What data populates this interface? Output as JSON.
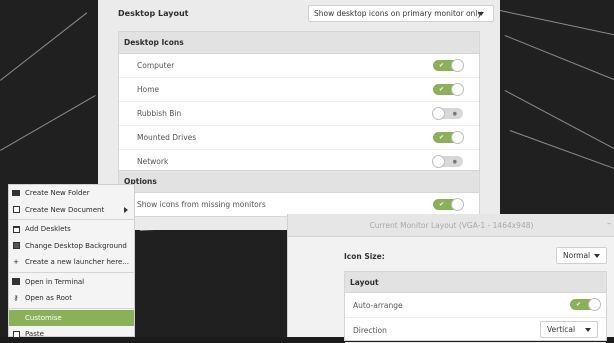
{
  "settings": {
    "desktop_layout_label": "Desktop Layout",
    "desktop_layout_value": "Show desktop icons on primary monitor only",
    "desktop_icons": {
      "header": "Desktop Icons",
      "items": [
        {
          "label": "Computer",
          "on": true
        },
        {
          "label": "Home",
          "on": true
        },
        {
          "label": "Rubbish Bin",
          "on": false
        },
        {
          "label": "Mounted Drives",
          "on": true
        },
        {
          "label": "Network",
          "on": false
        }
      ]
    },
    "options": {
      "header": "Options",
      "items": [
        {
          "label": "Show icons from missing monitors",
          "on": true
        }
      ]
    }
  },
  "monitor_window": {
    "title": "Current Monitor Layout (VGA-1 - 1464x948)",
    "icon_size_label": "Icon Size:",
    "icon_size_value": "Normal",
    "layout": {
      "header": "Layout",
      "auto_arrange_label": "Auto-arrange",
      "auto_arrange_on": true,
      "direction_label": "Direction",
      "direction_value": "Vertical"
    }
  },
  "context_menu": {
    "items": [
      {
        "label": "Create New Folder",
        "icon": "folder-icon"
      },
      {
        "label": "Create New Document",
        "icon": "document-icon",
        "submenu": true
      },
      {
        "label": "Add Desklets",
        "icon": "desklet-icon"
      },
      {
        "label": "Change Desktop Background",
        "icon": "image-icon"
      },
      {
        "label": "Create a new launcher here...",
        "icon": "plus-icon"
      },
      {
        "label": "Open in Terminal",
        "icon": "terminal-icon"
      },
      {
        "label": "Open as Root",
        "icon": "key-icon"
      },
      {
        "label": "Customise",
        "icon": "",
        "highlighted": true
      },
      {
        "label": "Paste",
        "icon": "paste-icon"
      }
    ]
  },
  "colors": {
    "accent": "#8ab157",
    "wallpaper": "#202020"
  }
}
